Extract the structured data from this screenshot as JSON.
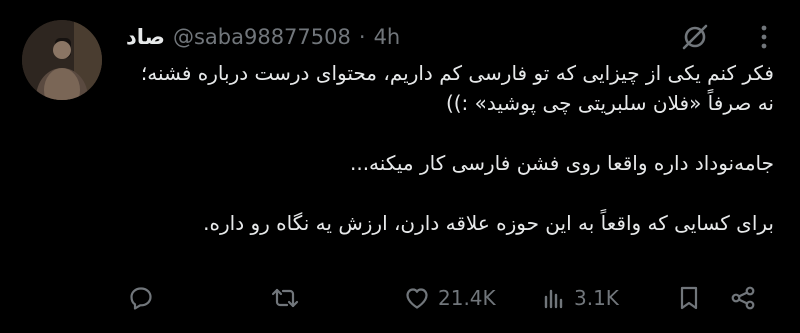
{
  "user": {
    "display_name": "صاد",
    "handle": "@saba98877508",
    "separator": "·",
    "time": "4h"
  },
  "tweet": {
    "lines": [
      "فکر کنم یکی از چیزایی که تو فارسی کم داریم، محتوای درست درباره فشنه؛",
      "نه صرفاً «فلان سلبریتی چی پوشید» :))",
      "جامه‌نوداد داره واقعا روی فشن فارسی کار میکنه...",
      "برای کسایی که واقعاً به این حوزه علاقه دارن، ارزش یه نگاه رو داره."
    ]
  },
  "actions": {
    "reply_icon": "reply-icon",
    "retweet_icon": "retweet-icon",
    "like_icon": "heart-icon",
    "like_count": "21.4K",
    "views_icon": "views-icon",
    "views_count": "3.1K",
    "bookmark_icon": "bookmark-icon",
    "share_icon": "share-icon"
  },
  "colors": {
    "background": "#000000",
    "text": "#e7e9ea",
    "secondary": "#71767b"
  }
}
